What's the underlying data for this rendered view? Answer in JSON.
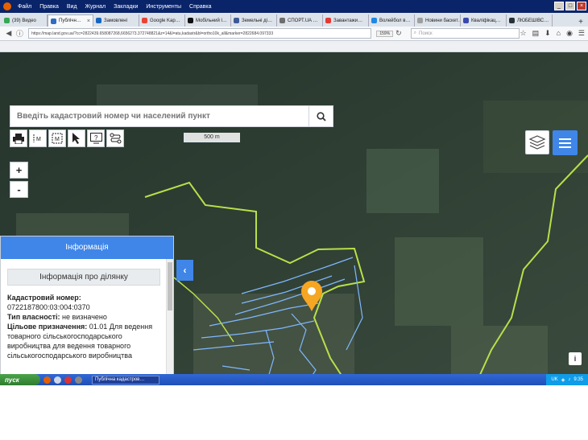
{
  "browser": {
    "menu": [
      "Файл",
      "Правка",
      "Вид",
      "Журнал",
      "Закладки",
      "Инструменты",
      "Справка"
    ],
    "tabs": [
      {
        "label": "(39) Видео",
        "color": "#34a853",
        "active": false
      },
      {
        "label": "Публічн…",
        "color": "#2d6cc0",
        "active": true
      },
      {
        "label": "Замовлені",
        "color": "#1565c0",
        "active": false
      },
      {
        "label": "Google Kap…",
        "color": "#ea4335",
        "active": false
      },
      {
        "label": "Мобільний l…",
        "color": "#111111",
        "active": false
      },
      {
        "label": "Земельні ді…",
        "color": "#3b5998",
        "active": false
      },
      {
        "label": "СПОРТ.UA …",
        "color": "#6d6d6d",
        "active": false
      },
      {
        "label": "Завантажи…",
        "color": "#e53935",
        "active": false
      },
      {
        "label": "Волейбол в…",
        "color": "#1e88e5",
        "active": false
      },
      {
        "label": "Новини баскет…",
        "color": "#9e9e9e",
        "active": false
      },
      {
        "label": "Кваліфікац…",
        "color": "#3949ab",
        "active": false
      },
      {
        "label": "ЛЮБЕШІВС…",
        "color": "#263238",
        "active": false
      }
    ],
    "new_tab": "+",
    "url": "https://map.land.gov.ua/?cc=2822439.658087268,6656273.372748821&z=14&l=atu,kadastr&bl=ortho10k_all&marker=2822684.097333",
    "zoom": "159%",
    "search_placeholder": "Поиск"
  },
  "map": {
    "search_placeholder": "Введіть кадастровий номер чи населений пункт",
    "tools": [
      "print-icon",
      "measure-distance-icon",
      "measure-area-icon",
      "pointer-icon",
      "help-icon",
      "route-icon"
    ],
    "scale": "500 m",
    "zoom_in": "+",
    "zoom_out": "-",
    "info_button": "i",
    "marker_color": "#f5a623"
  },
  "info": {
    "header": "Інформація",
    "title": "Інформація про ділянку",
    "cadastral_label": "Кадастровий номер:",
    "cadastral_value": "0722187800:03:004:0370",
    "ownership_label": "Тип власності:",
    "ownership_value": "не визначено",
    "purpose_label": "Цільове призначення:",
    "purpose_value": "01.01 Для ведення товарного сільськогосподарського виробництва для ведення товарного сільськогосподарського виробництва"
  },
  "taskbar": {
    "start": "пуск",
    "task": "Публічна кадастров…",
    "lang": "UK",
    "time": "9:35"
  },
  "colors": {
    "accent": "#3f86e8",
    "parcel_outline": "#b8e04a",
    "parcel_lines": "#7fb8ff"
  }
}
